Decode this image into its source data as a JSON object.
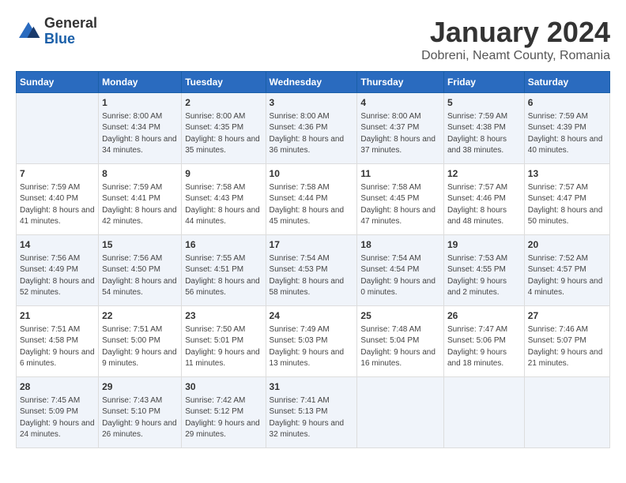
{
  "logo": {
    "general": "General",
    "blue": "Blue"
  },
  "header": {
    "title": "January 2024",
    "subtitle": "Dobreni, Neamt County, Romania"
  },
  "weekdays": [
    "Sunday",
    "Monday",
    "Tuesday",
    "Wednesday",
    "Thursday",
    "Friday",
    "Saturday"
  ],
  "weeks": [
    [
      {
        "day": "",
        "sunrise": "",
        "sunset": "",
        "daylight": ""
      },
      {
        "day": "1",
        "sunrise": "Sunrise: 8:00 AM",
        "sunset": "Sunset: 4:34 PM",
        "daylight": "Daylight: 8 hours and 34 minutes."
      },
      {
        "day": "2",
        "sunrise": "Sunrise: 8:00 AM",
        "sunset": "Sunset: 4:35 PM",
        "daylight": "Daylight: 8 hours and 35 minutes."
      },
      {
        "day": "3",
        "sunrise": "Sunrise: 8:00 AM",
        "sunset": "Sunset: 4:36 PM",
        "daylight": "Daylight: 8 hours and 36 minutes."
      },
      {
        "day": "4",
        "sunrise": "Sunrise: 8:00 AM",
        "sunset": "Sunset: 4:37 PM",
        "daylight": "Daylight: 8 hours and 37 minutes."
      },
      {
        "day": "5",
        "sunrise": "Sunrise: 7:59 AM",
        "sunset": "Sunset: 4:38 PM",
        "daylight": "Daylight: 8 hours and 38 minutes."
      },
      {
        "day": "6",
        "sunrise": "Sunrise: 7:59 AM",
        "sunset": "Sunset: 4:39 PM",
        "daylight": "Daylight: 8 hours and 40 minutes."
      }
    ],
    [
      {
        "day": "7",
        "sunrise": "Sunrise: 7:59 AM",
        "sunset": "Sunset: 4:40 PM",
        "daylight": "Daylight: 8 hours and 41 minutes."
      },
      {
        "day": "8",
        "sunrise": "Sunrise: 7:59 AM",
        "sunset": "Sunset: 4:41 PM",
        "daylight": "Daylight: 8 hours and 42 minutes."
      },
      {
        "day": "9",
        "sunrise": "Sunrise: 7:58 AM",
        "sunset": "Sunset: 4:43 PM",
        "daylight": "Daylight: 8 hours and 44 minutes."
      },
      {
        "day": "10",
        "sunrise": "Sunrise: 7:58 AM",
        "sunset": "Sunset: 4:44 PM",
        "daylight": "Daylight: 8 hours and 45 minutes."
      },
      {
        "day": "11",
        "sunrise": "Sunrise: 7:58 AM",
        "sunset": "Sunset: 4:45 PM",
        "daylight": "Daylight: 8 hours and 47 minutes."
      },
      {
        "day": "12",
        "sunrise": "Sunrise: 7:57 AM",
        "sunset": "Sunset: 4:46 PM",
        "daylight": "Daylight: 8 hours and 48 minutes."
      },
      {
        "day": "13",
        "sunrise": "Sunrise: 7:57 AM",
        "sunset": "Sunset: 4:47 PM",
        "daylight": "Daylight: 8 hours and 50 minutes."
      }
    ],
    [
      {
        "day": "14",
        "sunrise": "Sunrise: 7:56 AM",
        "sunset": "Sunset: 4:49 PM",
        "daylight": "Daylight: 8 hours and 52 minutes."
      },
      {
        "day": "15",
        "sunrise": "Sunrise: 7:56 AM",
        "sunset": "Sunset: 4:50 PM",
        "daylight": "Daylight: 8 hours and 54 minutes."
      },
      {
        "day": "16",
        "sunrise": "Sunrise: 7:55 AM",
        "sunset": "Sunset: 4:51 PM",
        "daylight": "Daylight: 8 hours and 56 minutes."
      },
      {
        "day": "17",
        "sunrise": "Sunrise: 7:54 AM",
        "sunset": "Sunset: 4:53 PM",
        "daylight": "Daylight: 8 hours and 58 minutes."
      },
      {
        "day": "18",
        "sunrise": "Sunrise: 7:54 AM",
        "sunset": "Sunset: 4:54 PM",
        "daylight": "Daylight: 9 hours and 0 minutes."
      },
      {
        "day": "19",
        "sunrise": "Sunrise: 7:53 AM",
        "sunset": "Sunset: 4:55 PM",
        "daylight": "Daylight: 9 hours and 2 minutes."
      },
      {
        "day": "20",
        "sunrise": "Sunrise: 7:52 AM",
        "sunset": "Sunset: 4:57 PM",
        "daylight": "Daylight: 9 hours and 4 minutes."
      }
    ],
    [
      {
        "day": "21",
        "sunrise": "Sunrise: 7:51 AM",
        "sunset": "Sunset: 4:58 PM",
        "daylight": "Daylight: 9 hours and 6 minutes."
      },
      {
        "day": "22",
        "sunrise": "Sunrise: 7:51 AM",
        "sunset": "Sunset: 5:00 PM",
        "daylight": "Daylight: 9 hours and 9 minutes."
      },
      {
        "day": "23",
        "sunrise": "Sunrise: 7:50 AM",
        "sunset": "Sunset: 5:01 PM",
        "daylight": "Daylight: 9 hours and 11 minutes."
      },
      {
        "day": "24",
        "sunrise": "Sunrise: 7:49 AM",
        "sunset": "Sunset: 5:03 PM",
        "daylight": "Daylight: 9 hours and 13 minutes."
      },
      {
        "day": "25",
        "sunrise": "Sunrise: 7:48 AM",
        "sunset": "Sunset: 5:04 PM",
        "daylight": "Daylight: 9 hours and 16 minutes."
      },
      {
        "day": "26",
        "sunrise": "Sunrise: 7:47 AM",
        "sunset": "Sunset: 5:06 PM",
        "daylight": "Daylight: 9 hours and 18 minutes."
      },
      {
        "day": "27",
        "sunrise": "Sunrise: 7:46 AM",
        "sunset": "Sunset: 5:07 PM",
        "daylight": "Daylight: 9 hours and 21 minutes."
      }
    ],
    [
      {
        "day": "28",
        "sunrise": "Sunrise: 7:45 AM",
        "sunset": "Sunset: 5:09 PM",
        "daylight": "Daylight: 9 hours and 24 minutes."
      },
      {
        "day": "29",
        "sunrise": "Sunrise: 7:43 AM",
        "sunset": "Sunset: 5:10 PM",
        "daylight": "Daylight: 9 hours and 26 minutes."
      },
      {
        "day": "30",
        "sunrise": "Sunrise: 7:42 AM",
        "sunset": "Sunset: 5:12 PM",
        "daylight": "Daylight: 9 hours and 29 minutes."
      },
      {
        "day": "31",
        "sunrise": "Sunrise: 7:41 AM",
        "sunset": "Sunset: 5:13 PM",
        "daylight": "Daylight: 9 hours and 32 minutes."
      },
      {
        "day": "",
        "sunrise": "",
        "sunset": "",
        "daylight": ""
      },
      {
        "day": "",
        "sunrise": "",
        "sunset": "",
        "daylight": ""
      },
      {
        "day": "",
        "sunrise": "",
        "sunset": "",
        "daylight": ""
      }
    ]
  ]
}
